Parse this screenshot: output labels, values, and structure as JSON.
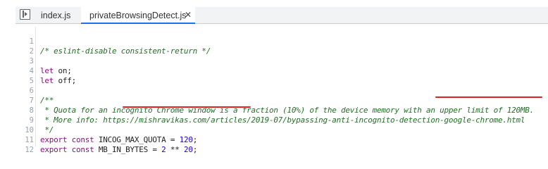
{
  "tabs": {
    "index_label": "index.js",
    "active_label": "privateBrowsingDetect.js",
    "close_glyph": "✕"
  },
  "editor": {
    "lines": [
      {
        "num": "1",
        "text": "/* eslint-disable consistent-return */"
      },
      {
        "num": "2",
        "text": ""
      },
      {
        "num": "3",
        "text": "let on;"
      },
      {
        "num": "4",
        "text": "let off;"
      },
      {
        "num": "5",
        "text": ""
      },
      {
        "num": "6",
        "text": "/**"
      },
      {
        "num": "7",
        "text": " * Quota for an incognito Chrome window is a fraction (10%) of the device memory with an upper limit of 120MB."
      },
      {
        "num": "8",
        "text": " * More info: https://mishravikas.com/articles/2019-07/bypassing-anti-incognito-detection-google-chrome.html"
      },
      {
        "num": "9",
        "text": " */"
      },
      {
        "num": "10",
        "text": "export const INCOG_MAX_QUOTA = 120;"
      },
      {
        "num": "11",
        "text": "export const MB_IN_BYTES = 2 ** 20;"
      },
      {
        "num": "12",
        "text": ""
      }
    ]
  },
  "colors": {
    "comment": "#236e25",
    "keyword": "#881280",
    "number": "#1c00cf",
    "annotation_underline": "#e02020",
    "active_tab_indicator": "#1a73e8"
  }
}
